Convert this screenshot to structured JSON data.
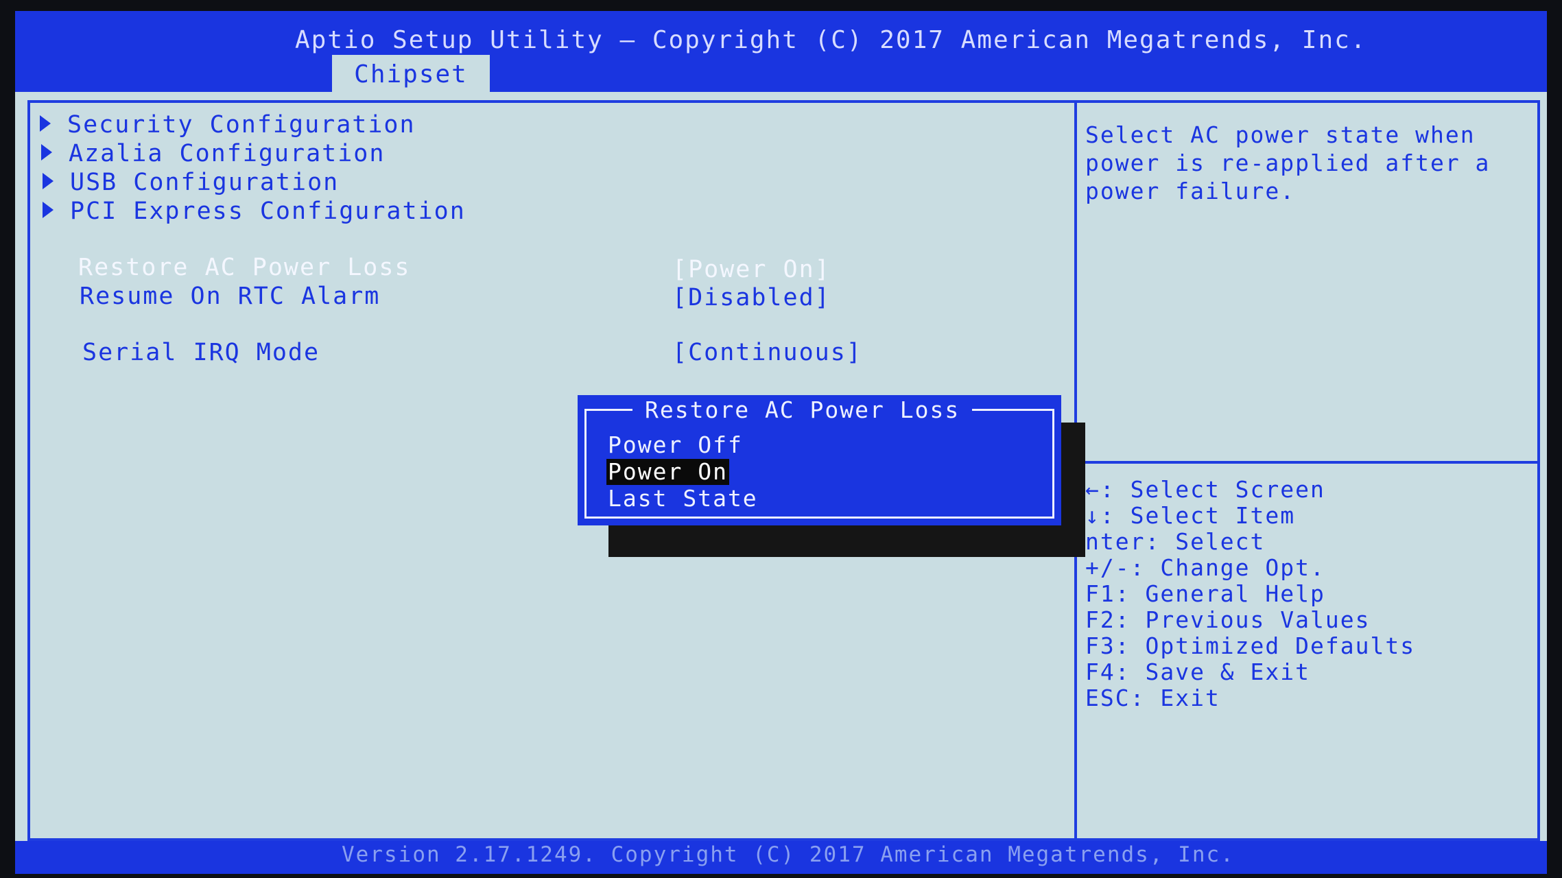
{
  "header": {
    "title": "Aptio Setup Utility – Copyright (C) 2017 American Megatrends, Inc.",
    "active_tab": "Chipset"
  },
  "menu": {
    "submenus": [
      {
        "label": "Security Configuration"
      },
      {
        "label": "Azalia Configuration"
      },
      {
        "label": "USB Configuration"
      },
      {
        "label": "PCI Express Configuration"
      }
    ],
    "settings": [
      {
        "label": "Restore AC Power Loss",
        "value": "[Power On]",
        "selected": true
      },
      {
        "label": "Resume On RTC Alarm",
        "value": "[Disabled]",
        "selected": false
      },
      {
        "label": "Serial IRQ Mode",
        "value": "[Continuous]",
        "selected": false
      }
    ]
  },
  "help": {
    "description": "Select AC power state when power is re-applied after a power failure.",
    "keys": [
      "←: Select Screen",
      "↓: Select Item",
      "nter: Select",
      "+/-: Change Opt.",
      "F1: General Help",
      "F2: Previous Values",
      "F3: Optimized Defaults",
      "F4: Save & Exit",
      "ESC: Exit"
    ]
  },
  "popup": {
    "title": "Restore AC Power Loss",
    "options": [
      "Power Off",
      "Power On",
      "Last State"
    ],
    "selected": "Power On"
  },
  "footer": {
    "text": "Version 2.17.1249. Copyright (C) 2017 American Megatrends, Inc."
  },
  "colors": {
    "bios_blue": "#1a35e0",
    "background": "#c9dde2",
    "highlight_text": "#f4f7ff",
    "selection_bg": "#0a0a0a"
  }
}
